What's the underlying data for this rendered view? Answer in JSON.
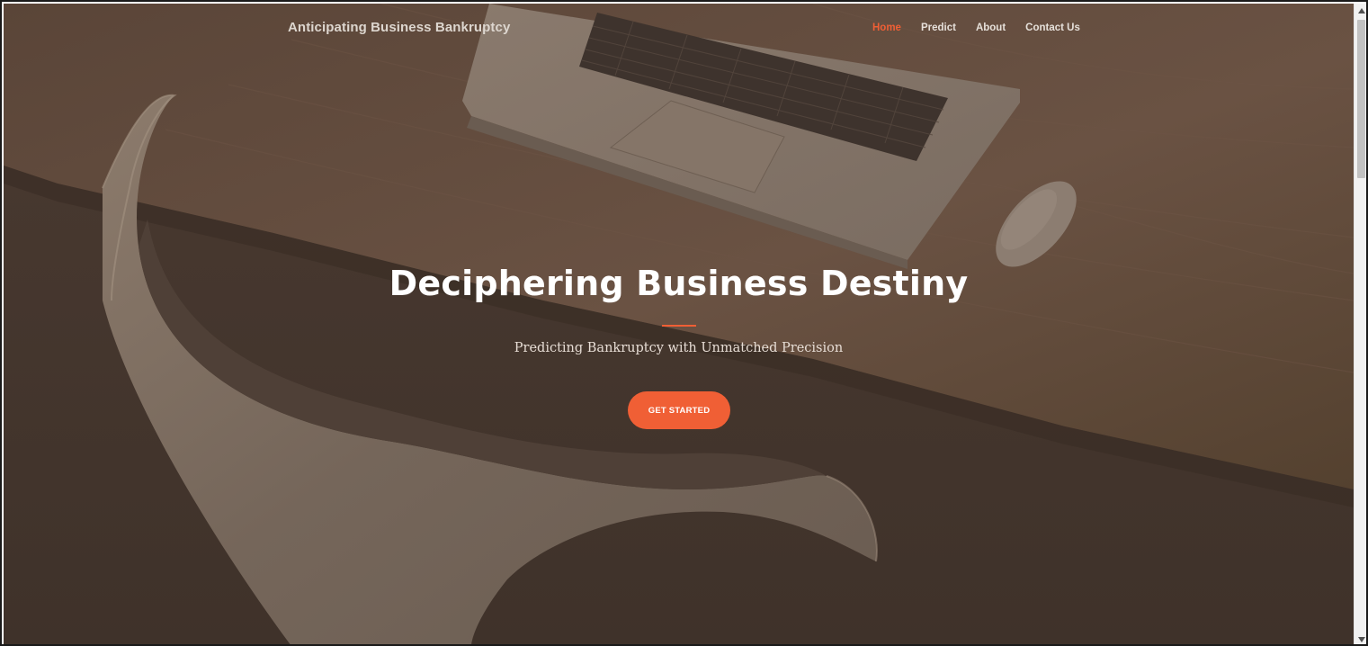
{
  "navbar": {
    "brand": "Anticipating Business Bankruptcy",
    "links": [
      {
        "label": "Home",
        "active": true
      },
      {
        "label": "Predict",
        "active": false
      },
      {
        "label": "About",
        "active": false
      },
      {
        "label": "Contact Us",
        "active": false
      }
    ]
  },
  "hero": {
    "title": "Deciphering Business Destiny",
    "subtitle": "Predicting Bankruptcy with Unmatched Precision",
    "cta_label": "GET STARTED",
    "overlay_color": "#4a3a31",
    "accent_color": "#f05f35",
    "background_image": "laptop-mouse-chair-on-desk-photo"
  },
  "scrollbar": {
    "up_icon": "arrow-up-icon",
    "down_icon": "arrow-down-icon"
  }
}
